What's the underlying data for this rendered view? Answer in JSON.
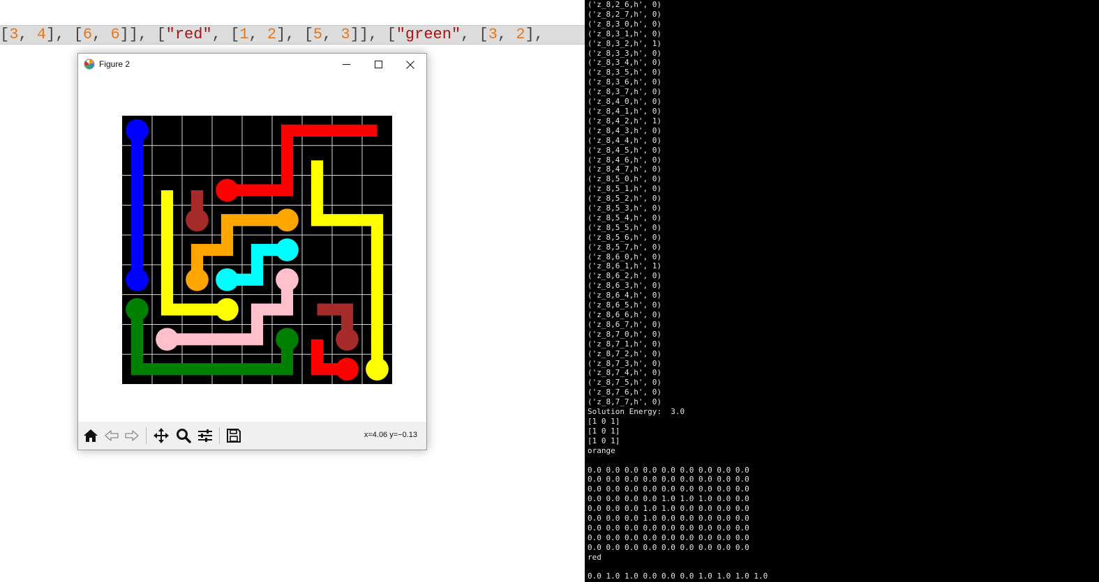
{
  "code_strip": {
    "tokens": [
      {
        "t": "[",
        "k": "pun"
      },
      {
        "t": "3",
        "k": "num"
      },
      {
        "t": ", ",
        "k": "pun"
      },
      {
        "t": "4",
        "k": "num"
      },
      {
        "t": "], [",
        "k": "pun"
      },
      {
        "t": "6",
        "k": "num"
      },
      {
        "t": ", ",
        "k": "pun"
      },
      {
        "t": "6",
        "k": "num"
      },
      {
        "t": "]], [",
        "k": "pun"
      },
      {
        "t": "\"red\"",
        "k": "str"
      },
      {
        "t": ", [",
        "k": "pun"
      },
      {
        "t": "1",
        "k": "num"
      },
      {
        "t": ", ",
        "k": "pun"
      },
      {
        "t": "2",
        "k": "num"
      },
      {
        "t": "], [",
        "k": "pun"
      },
      {
        "t": "5",
        "k": "num"
      },
      {
        "t": ", ",
        "k": "pun"
      },
      {
        "t": "3",
        "k": "num"
      },
      {
        "t": "]], [",
        "k": "pun"
      },
      {
        "t": "\"green\"",
        "k": "str"
      },
      {
        "t": ", [",
        "k": "pun"
      },
      {
        "t": "3",
        "k": "num"
      },
      {
        "t": ", ",
        "k": "pun"
      },
      {
        "t": "2",
        "k": "num"
      },
      {
        "t": "],",
        "k": "pun"
      }
    ]
  },
  "figure": {
    "title": "Figure 2",
    "coords": "x=4.06 y=−0.13",
    "toolbar": [
      "home-icon",
      "back-arrow-icon",
      "forward-arrow-icon",
      "pan-icon",
      "zoom-icon",
      "configure-subplots-icon",
      "save-icon"
    ],
    "grid": {
      "size": 9,
      "background": "#000000",
      "gridline_color": "#d9d9d9",
      "flows": [
        {
          "color": "#0000ff",
          "cells": [
            [
              0,
              0
            ],
            [
              0,
              5
            ]
          ],
          "ends": [
            [
              0,
              0
            ],
            [
              0,
              5
            ]
          ]
        },
        {
          "color": "#ff0000",
          "cells": [
            [
              8,
              0
            ],
            [
              5,
              0
            ],
            [
              5,
              2
            ],
            [
              3,
              2
            ]
          ],
          "ends": [
            [
              3,
              2
            ]
          ]
        },
        {
          "color": "#ffff00",
          "cells": [
            [
              1,
              2
            ],
            [
              1,
              6
            ],
            [
              3,
              6
            ]
          ],
          "ends": [
            [
              3,
              6
            ]
          ]
        },
        {
          "color": "#ffff00",
          "cells": [
            [
              6,
              1
            ],
            [
              6,
              3
            ],
            [
              8,
              3
            ],
            [
              8,
              8
            ]
          ],
          "ends": [
            [
              8,
              8
            ]
          ]
        },
        {
          "color": "#a52a2a",
          "cells": [
            [
              2,
              2
            ],
            [
              2,
              3
            ]
          ],
          "ends": [
            [
              2,
              3
            ]
          ]
        },
        {
          "color": "#ffa500",
          "cells": [
            [
              5,
              3
            ],
            [
              3,
              3
            ],
            [
              3,
              4
            ],
            [
              2,
              4
            ],
            [
              2,
              5
            ]
          ],
          "ends": [
            [
              5,
              3
            ],
            [
              2,
              5
            ]
          ]
        },
        {
          "color": "#00ffff",
          "cells": [
            [
              5,
              4
            ],
            [
              4,
              4
            ],
            [
              4,
              5
            ],
            [
              3,
              5
            ]
          ],
          "ends": [
            [
              5,
              4
            ],
            [
              3,
              5
            ]
          ]
        },
        {
          "color": "#ffc0cb",
          "cells": [
            [
              5,
              5
            ],
            [
              5,
              6
            ],
            [
              4,
              6
            ],
            [
              4,
              7
            ],
            [
              1,
              7
            ]
          ],
          "ends": [
            [
              5,
              5
            ],
            [
              1,
              7
            ]
          ]
        },
        {
          "color": "#008000",
          "cells": [
            [
              0,
              6
            ],
            [
              0,
              8
            ],
            [
              5,
              8
            ],
            [
              5,
              7
            ]
          ],
          "ends": [
            [
              0,
              6
            ],
            [
              5,
              7
            ]
          ]
        },
        {
          "color": "#a52a2a",
          "cells": [
            [
              6,
              6
            ],
            [
              7,
              6
            ],
            [
              7,
              7
            ]
          ],
          "ends": [
            [
              7,
              7
            ]
          ]
        },
        {
          "color": "#ff0000",
          "cells": [
            [
              6,
              7
            ],
            [
              6,
              8
            ],
            [
              7,
              8
            ]
          ],
          "ends": [
            [
              7,
              8
            ]
          ]
        }
      ]
    }
  },
  "terminal": {
    "lines": [
      "('z_8,2_6,h', 0)",
      "('z_8,2_7,h', 0)",
      "('z_8,3_0,h', 0)",
      "('z_8,3_1,h', 0)",
      "('z_8,3_2,h', 1)",
      "('z_8,3_3,h', 0)",
      "('z_8,3_4,h', 0)",
      "('z_8,3_5,h', 0)",
      "('z_8,3_6,h', 0)",
      "('z_8,3_7,h', 0)",
      "('z_8,4_0,h', 0)",
      "('z_8,4_1,h', 0)",
      "('z_8,4_2,h', 1)",
      "('z_8,4_3,h', 0)",
      "('z_8,4_4,h', 0)",
      "('z_8,4_5,h', 0)",
      "('z_8,4_6,h', 0)",
      "('z_8,4_7,h', 0)",
      "('z_8,5_0,h', 0)",
      "('z_8,5_1,h', 0)",
      "('z_8,5_2,h', 0)",
      "('z_8,5_3,h', 0)",
      "('z_8,5_4,h', 0)",
      "('z_8,5_5,h', 0)",
      "('z_8,5_6,h', 0)",
      "('z_8,5_7,h', 0)",
      "('z_8,6_0,h', 0)",
      "('z_8,6_1,h', 1)",
      "('z_8,6_2,h', 0)",
      "('z_8,6_3,h', 0)",
      "('z_8,6_4,h', 0)",
      "('z_8,6_5,h', 0)",
      "('z_8,6_6,h', 0)",
      "('z_8,6_7,h', 0)",
      "('z_8,7_0,h', 0)",
      "('z_8,7_1,h', 0)",
      "('z_8,7_2,h', 0)",
      "('z_8,7_3,h', 0)",
      "('z_8,7_4,h', 0)",
      "('z_8,7_5,h', 0)",
      "('z_8,7_6,h', 0)",
      "('z_8,7_7,h', 0)",
      "Solution Energy:  3.0",
      "[1 0 1]",
      "[1 0 1]",
      "[1 0 1]",
      "orange",
      "",
      "0.0 0.0 0.0 0.0 0.0 0.0 0.0 0.0 0.0",
      "0.0 0.0 0.0 0.0 0.0 0.0 0.0 0.0 0.0",
      "0.0 0.0 0.0 0.0 0.0 0.0 0.0 0.0 0.0",
      "0.0 0.0 0.0 0.0 1.0 1.0 1.0 0.0 0.0",
      "0.0 0.0 0.0 1.0 1.0 0.0 0.0 0.0 0.0",
      "0.0 0.0 0.0 1.0 0.0 0.0 0.0 0.0 0.0",
      "0.0 0.0 0.0 0.0 0.0 0.0 0.0 0.0 0.0",
      "0.0 0.0 0.0 0.0 0.0 0.0 0.0 0.0 0.0",
      "0.0 0.0 0.0 0.0 0.0 0.0 0.0 0.0 0.0",
      "red",
      "",
      "0.0 1.0 1.0 0.0 0.0 0.0 1.0 1.0 1.0 1.0"
    ]
  }
}
